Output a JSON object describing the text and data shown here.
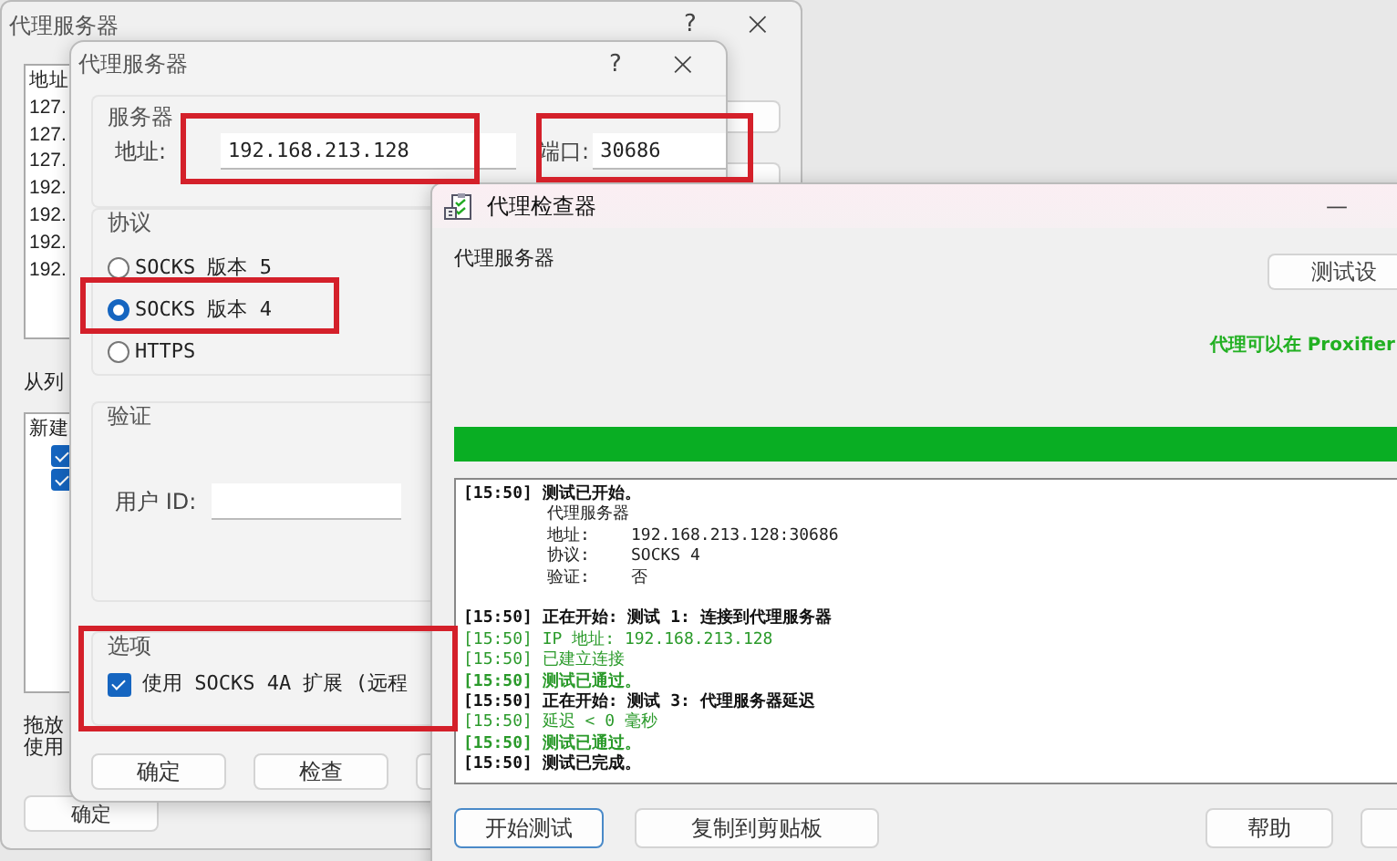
{
  "background_window": {
    "title": "代理服务器",
    "help": "?",
    "close": "×",
    "list_lines": [
      "地址",
      "127.",
      "127.",
      "127.",
      "192.",
      "192.",
      "192.",
      "192."
    ],
    "list_label": "从列",
    "rules_list": {
      "header": "新建",
      "items": [
        {
          "checked": true
        },
        {
          "checked": true
        }
      ]
    },
    "hint_lines": [
      "拖放",
      "使用"
    ],
    "ok_button": "确定"
  },
  "proxy_dialog": {
    "title": "代理服务器",
    "help": "?",
    "close": "×",
    "server": {
      "legend": "服务器",
      "address_label": "地址:",
      "address": "192.168.213.128",
      "port_label": "端口:",
      "port": "30686"
    },
    "protocol": {
      "legend": "协议",
      "options": [
        {
          "label": "SOCKS 版本 5",
          "selected": false
        },
        {
          "label": "SOCKS 版本 4",
          "selected": true
        },
        {
          "label": "HTTPS",
          "selected": false
        }
      ]
    },
    "auth": {
      "legend": "验证",
      "user_id_label": "用户 ID:"
    },
    "options": {
      "legend": "选项",
      "items": [
        {
          "label": "使用 SOCKS 4A 扩展 (远程",
          "checked": true
        }
      ]
    },
    "buttons": [
      "确定",
      "检查"
    ]
  },
  "checker": {
    "title": "代理检查器",
    "minimize": "—",
    "section_label": "代理服务器",
    "settings_button": "测试设",
    "status": "代理可以在 Proxifier",
    "progress": {
      "level": 1
    },
    "log": [
      {
        "kind": "heading",
        "text": "[15:50] 测试已开始。"
      },
      {
        "kind": "detail",
        "label": "代理服务器"
      },
      {
        "kind": "detail",
        "label": "地址:",
        "value": "192.168.213.128:30686"
      },
      {
        "kind": "detail",
        "label": "协议:",
        "value": "SOCKS 4"
      },
      {
        "kind": "detail",
        "label": "验证:",
        "value": "否"
      },
      {
        "kind": "heading",
        "text": "[15:50] 正在开始: 测试 1: 连接到代理服务器"
      },
      {
        "kind": "info",
        "text": "[15:50] IP 地址: 192.168.213.128"
      },
      {
        "kind": "info",
        "text": "[15:50] 已建立连接"
      },
      {
        "kind": "passed",
        "text": "[15:50] 测试已通过。"
      },
      {
        "kind": "heading",
        "text": "[15:50] 正在开始: 测试 3: 代理服务器延迟"
      },
      {
        "kind": "info",
        "text": "[15:50] 延迟 < 0 毫秒"
      },
      {
        "kind": "passed",
        "text": "[15:50] 测试已通过。"
      },
      {
        "kind": "heading",
        "text": "[15:50] 测试已完成。"
      }
    ],
    "buttons": [
      {
        "label": "开始测试",
        "focused": true
      },
      {
        "label": "复制到剪贴板",
        "focused": false
      },
      {
        "label": "帮助",
        "focused": false
      }
    ]
  }
}
